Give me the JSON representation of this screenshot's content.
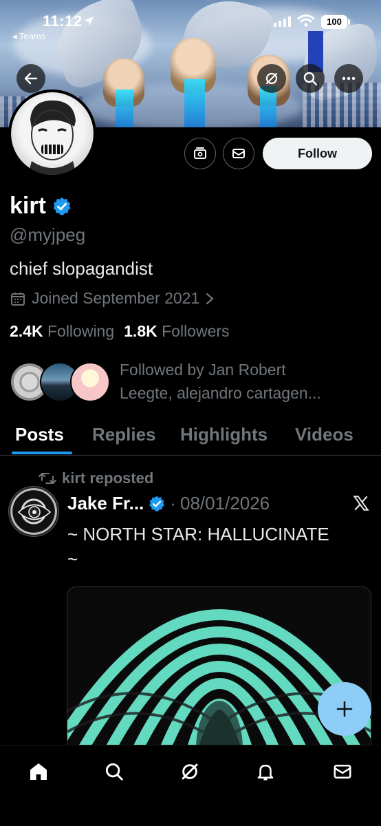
{
  "status_bar": {
    "time": "11:12",
    "back_app": "◂ Teams",
    "battery": "100"
  },
  "header": {
    "icons": [
      "back-arrow-icon",
      "grok-icon",
      "search-icon",
      "more-icon"
    ]
  },
  "profile": {
    "display_name": "kirt",
    "verified": true,
    "handle": "@myjpeg",
    "bio": "chief slopagandist",
    "joined": "Joined September 2021",
    "following_count": "2.4K",
    "following_label": "Following",
    "followers_count": "1.8K",
    "followers_label": "Followers",
    "followed_by_line1": "Followed by Jan Robert",
    "followed_by_line2": "Leegte, alejandro cartagen..."
  },
  "actions": {
    "follow_label": "Follow"
  },
  "tabs": [
    {
      "label": "Posts",
      "active": true
    },
    {
      "label": "Replies",
      "active": false
    },
    {
      "label": "Highlights",
      "active": false
    },
    {
      "label": "Videos",
      "active": false
    }
  ],
  "post": {
    "repost_label": "kirt reposted",
    "author": "Jake Fr...",
    "verified": true,
    "separator": "·",
    "date": "08/01/2026",
    "text_line1": "~ NORTH STAR: HALLUCINATE",
    "text_line2": "~"
  },
  "colors": {
    "accent": "#1d9bf0",
    "background": "#000000",
    "secondary_text": "#71767b",
    "fab": "#8ecdf8",
    "media_teal": "#63d9c0"
  },
  "bottom_nav": [
    "home-icon",
    "search-icon",
    "grok-icon",
    "notifications-icon",
    "messages-icon"
  ]
}
